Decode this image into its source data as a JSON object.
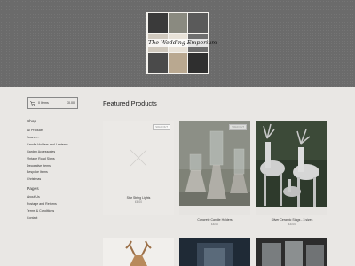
{
  "header": {
    "logo_text": "The Wedding Emporium",
    "logo_tiles": [
      "#3a3a3a",
      "#8a8a80",
      "#5a5a5a",
      "#cfc8bd",
      "#e8e2d8",
      "#6e6e6e",
      "#4a4a4a",
      "#b9a890",
      "#2f2f2f"
    ]
  },
  "cart": {
    "icon": "cart-icon",
    "items_label": "0 Items",
    "total": "£0.00"
  },
  "shop": {
    "heading": "Shop",
    "items": [
      "All Products",
      "Search...",
      "Candle Holders and Lanterns",
      "Garden Accessories",
      "Vintage Road Signs",
      "Decorative Items",
      "Bespoke Items",
      "Christmas"
    ]
  },
  "pages": {
    "heading": "Pages",
    "items": [
      "About Us",
      "Postage and Returns",
      "Terms & Conditions",
      "Contact"
    ]
  },
  "main": {
    "title": "Featured Products",
    "products": [
      {
        "name": "Star String Lights",
        "price": "£6.00",
        "badge": "SOLD OUT"
      },
      {
        "name": "Concrete Candle Holders",
        "price": "£8.00",
        "badge": "SOLD OUT"
      },
      {
        "name": "Silver Ceramic Stags - 3 sizes",
        "price": "£5.00",
        "badge": ""
      }
    ]
  },
  "colors": {
    "header_bg": "#6b6b6b",
    "page_bg": "#e9e7e4",
    "accent_text": "#222222"
  }
}
